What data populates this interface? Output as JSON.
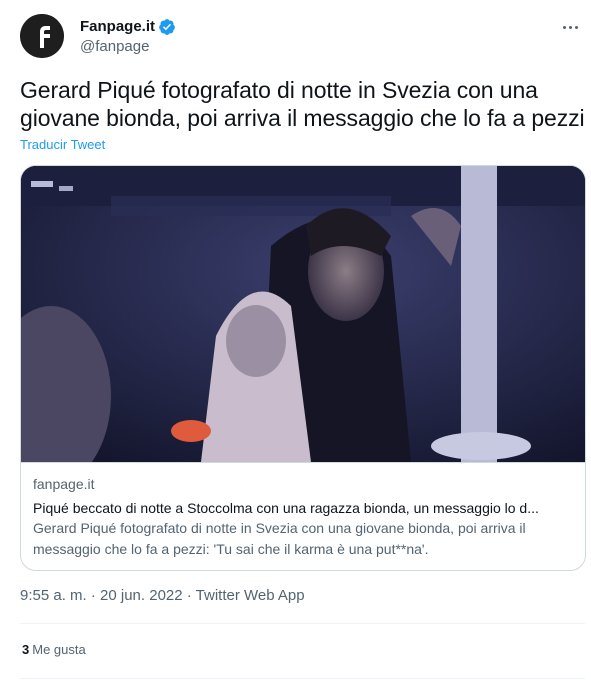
{
  "account": {
    "display_name": "Fanpage.it",
    "handle": "@fanpage",
    "verified": true,
    "avatar_icon": "fanpage-logo-icon",
    "more_icon": "more-options-icon"
  },
  "tweet": {
    "text": "Gerard Piqué fotografato di notte in Svezia con una giovane bionda, poi arriva il messaggio che lo fa a pezzi",
    "translate_label": "Traducir Tweet"
  },
  "link_card": {
    "domain": "fanpage.it",
    "title": "Piqué beccato di notte a Stoccolma con una ragazza bionda, un messaggio lo d...",
    "description": "Gerard Piqué fotografato di notte in Svezia con una giovane bionda, poi arriva il messaggio che lo fa a pezzi: 'Tu sai che il karma è una put**na'."
  },
  "meta": {
    "timestamp": "9:55 a. m. · 20 jun. 2022 · Twitter Web App"
  },
  "engagement": {
    "likes_count": "3",
    "likes_label": "Me gusta"
  },
  "colors": {
    "accent": "#1d9bf0",
    "secondary_text": "#536471",
    "border": "#cfd9de"
  }
}
